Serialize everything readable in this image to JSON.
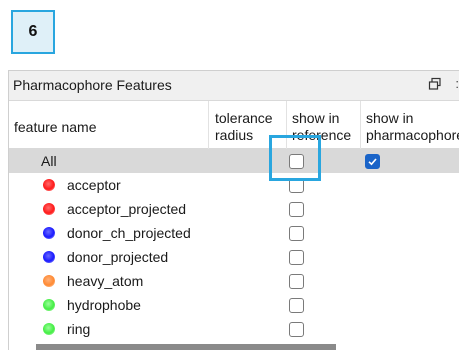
{
  "step_badge": {
    "number": "6"
  },
  "panel": {
    "title": "Pharmacophore Features",
    "close_fragment": ":"
  },
  "columns": {
    "feature_name": "feature name",
    "tolerance_radius": "tolerance radius",
    "show_in_reference": "show in reference",
    "show_in_pharmacophore": "show in pharmacophore"
  },
  "all_row": {
    "label": "All",
    "show_in_reference": false,
    "show_in_pharmacophore": true
  },
  "features": [
    {
      "label": "acceptor",
      "color": "#ff1a1a",
      "show_in_reference": false
    },
    {
      "label": "acceptor_projected",
      "color": "#ff1a1a",
      "show_in_reference": false
    },
    {
      "label": "donor_ch_projected",
      "color": "#1a1aff",
      "show_in_reference": false
    },
    {
      "label": "donor_projected",
      "color": "#1a1aff",
      "show_in_reference": false
    },
    {
      "label": "heavy_atom",
      "color": "#ff8a33",
      "show_in_reference": false
    },
    {
      "label": "hydrophobe",
      "color": "#44ee44",
      "show_in_reference": false
    },
    {
      "label": "ring",
      "color": "#44ee44",
      "show_in_reference": false
    }
  ],
  "colors": {
    "accent_highlight": "#29a6df",
    "checked_box": "#1a64c8",
    "selected_row": "#d9d9d9"
  }
}
